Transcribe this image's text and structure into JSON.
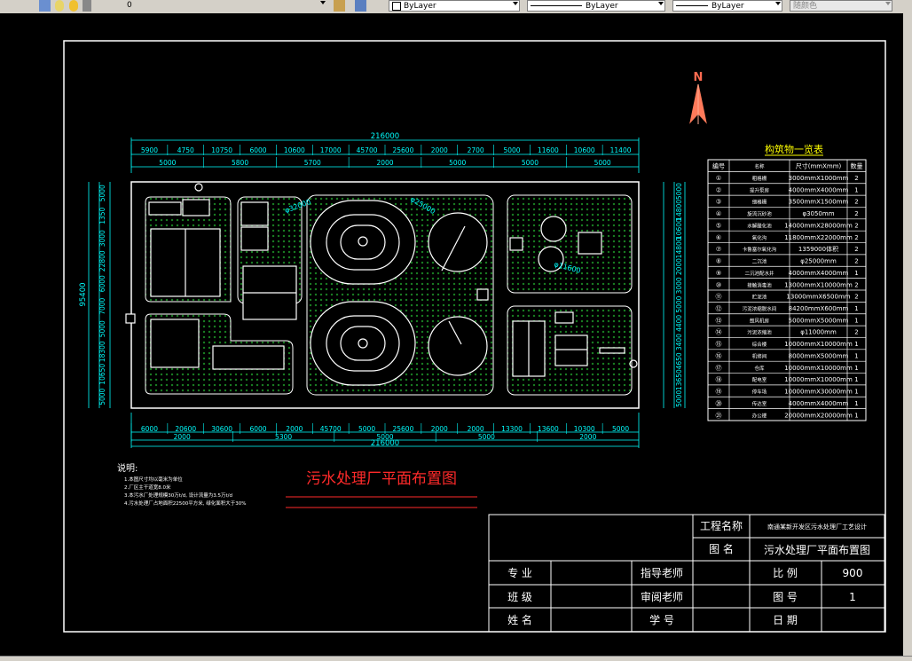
{
  "toolbar": {
    "layer_value": "0",
    "color_label": "ByLayer",
    "linetype_label": "ByLayer",
    "lineweight_label": "ByLayer",
    "plotstyle_label": "随颜色"
  },
  "drawing": {
    "north": "N",
    "main_title": "污水处理厂平面布置图",
    "dims": {
      "top_total": "216000",
      "top_row1": [
        "5900",
        "4750",
        "10750",
        "6000",
        "10600",
        "17000",
        "45700",
        "25600",
        "2000",
        "2700",
        "5000",
        "11600",
        "10600",
        "11400"
      ],
      "top_row2": [
        "5000",
        "5800",
        "5700",
        "2000",
        "5000",
        "5000",
        "5000"
      ],
      "bottom_row1": [
        "6000",
        "20600",
        "30600",
        "6000",
        "2000",
        "45700",
        "5000",
        "25600",
        "2000",
        "2000",
        "13300",
        "13600",
        "10300",
        "5000"
      ],
      "bottom_row2": [
        "2000",
        "5300",
        "5000",
        "5000",
        "2000"
      ],
      "bottom_total": "216000",
      "left_total": "95400",
      "left_vals": [
        "5000",
        "1350",
        "3000",
        "22800",
        "6000",
        "7000",
        "5000",
        "18300",
        "10650",
        "5000"
      ],
      "right_vals": [
        "5000",
        "14800",
        "10600",
        "14800",
        "2000",
        "3000",
        "5000",
        "4400",
        "3400",
        "4650",
        "13650",
        "5000"
      ],
      "diam_labels": [
        "φ32000",
        "φ25000",
        "φ11600"
      ]
    },
    "table": {
      "title": "构筑物一览表",
      "headers": [
        "编号",
        "名称",
        "尺寸(mmXmm)",
        "数量"
      ],
      "rows": [
        [
          "①",
          "粗格栅",
          "3000mmX1000mm",
          "2"
        ],
        [
          "②",
          "提升泵房",
          "4000mmX4000mm",
          "1"
        ],
        [
          "③",
          "细格栅",
          "3500mmX1500mm",
          "2"
        ],
        [
          "④",
          "旋流沉砂池",
          "φ3050mm",
          "2"
        ],
        [
          "⑤",
          "水解酸化池",
          "14000mmX28000mm",
          "2"
        ],
        [
          "⑥",
          "氧化沟",
          "11800mmX22000mm",
          "2"
        ],
        [
          "⑦",
          "卡鲁塞尔氧化沟",
          "1359000体积",
          "2"
        ],
        [
          "⑧",
          "二沉池",
          "φ25000mm",
          "2"
        ],
        [
          "⑨",
          "二沉池配水井",
          "4000mmX4000mm",
          "1"
        ],
        [
          "⑩",
          "接触消毒池",
          "13000mmX10000mm",
          "2"
        ],
        [
          "⑪",
          "贮泥池",
          "13000mmX6500mm",
          "2"
        ],
        [
          "⑫",
          "污泥浓缩脱水间",
          "84200mmX600mm",
          "1"
        ],
        [
          "⑬",
          "鼓风机房",
          "5000mmX5000mm",
          "1"
        ],
        [
          "⑭",
          "污泥浓缩池",
          "φ11000mm",
          "2"
        ],
        [
          "⑮",
          "综合楼",
          "10000mmX10000mm",
          "1"
        ],
        [
          "⑯",
          "机修间",
          "8000mmX5000mm",
          "1"
        ],
        [
          "⑰",
          "仓库",
          "10000mmX10000mm",
          "1"
        ],
        [
          "⑱",
          "配电室",
          "10000mmX10000mm",
          "1"
        ],
        [
          "⑲",
          "停车场",
          "10000mmX30000mm",
          "1"
        ],
        [
          "⑳",
          "传达室",
          "4000mmX4000mm",
          "1"
        ],
        [
          "㉑",
          "办公楼",
          "20000mmX20000mm",
          "1"
        ]
      ]
    },
    "notes": {
      "title": "说明:",
      "lines": [
        "1.本图尺寸均以毫米为单位",
        "2.厂区主干道宽8.0米",
        "3.本污水厂处理规模30万t/d, 设计流量为3.5万t/d",
        "4.污水处理厂占地面积22500平方米, 绿化面积大于30%"
      ]
    },
    "title_block": {
      "project_label": "工程名称",
      "project_value": "南通某新开发区污水处理厂工艺设计",
      "drawing_label": "图 名",
      "drawing_value": "污水处理厂平面布置图",
      "major": "专 业",
      "advisor": "指导老师",
      "scale_label": "比 例",
      "scale_value": "900",
      "class": "班 级",
      "reviewer": "审阅老师",
      "drawno_label": "图 号",
      "drawno_value": "1",
      "name": "姓 名",
      "student_no": "学 号",
      "date": "日 期"
    }
  }
}
